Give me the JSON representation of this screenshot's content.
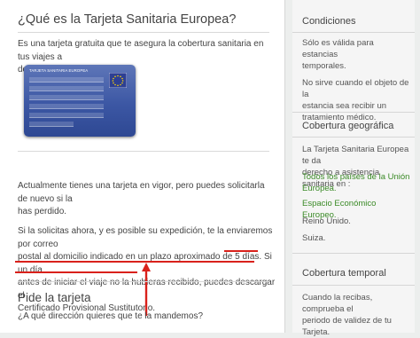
{
  "main": {
    "title": "¿Qué es la Tarjeta Sanitaria Europea?",
    "intro_lines": [
      "Es una tarjeta gratuita que te asegura la cobertura sanitaria en tus viajes a",
      "determinados países."
    ],
    "card": {
      "title": "TARJETA SANITARIA EUROPEA",
      "flag_icon": "eu-flag-icon"
    },
    "status_lines": [
      "Actualmente tienes una tarjeta en vigor, pero puedes solicitarla de nuevo si la",
      "has perdido."
    ],
    "request_lines": [
      "Si la solicitas ahora, y es posible su expedición, te la enviaremos por correo",
      "postal al domicilio indicado en un plazo aproximado de 5 días.",
      "Si un día",
      "antes de iniciar el viaje no la hubieras recibido, puedes descargar el",
      "Certificado Provisional Sustitutorio."
    ],
    "section2_title": "Pide la tarjeta",
    "question": "¿A qué dirección quieres que te la mandemos?"
  },
  "sidebar": {
    "conditions": {
      "title": "Condiciones",
      "items": [
        [
          "Sólo es válida para estancias",
          "temporales."
        ],
        [
          "No sirve cuando el objeto de la",
          "estancia sea recibir un",
          "tratamiento médico."
        ]
      ]
    },
    "coverage_geo": {
      "title": "Cobertura geográfica",
      "text": [
        "La Tarjeta Sanitaria Europea te da",
        "derecho a asistencia sanitaria en :"
      ],
      "items": [
        {
          "label": [
            "Todos los países de la Unión",
            "Europea."
          ],
          "link": true
        },
        {
          "label": [
            "Espacio Económico Europeo."
          ],
          "link": true
        },
        {
          "label": [
            "Reino Unido."
          ],
          "link": false
        },
        {
          "label": [
            "Suiza."
          ],
          "link": false
        }
      ]
    },
    "coverage_temp": {
      "title": "Cobertura temporal",
      "text": [
        "Cuando la recibas, comprueba el",
        "periodo de validez de tu Tarjeta."
      ]
    }
  },
  "colors": {
    "underline": "#d9211b",
    "link": "#3a8a26",
    "card": "#3c57a4"
  }
}
